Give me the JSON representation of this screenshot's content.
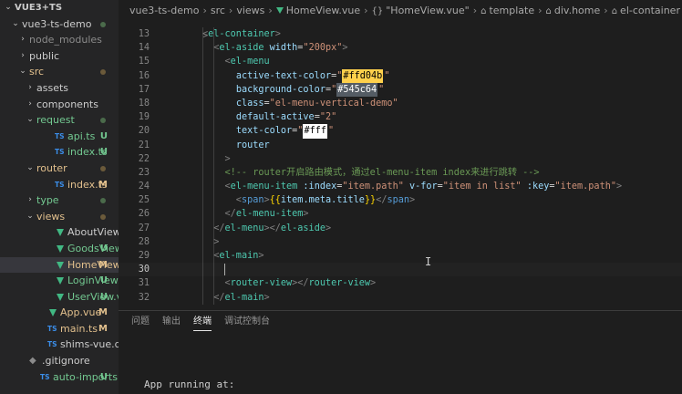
{
  "explorer": {
    "items": [
      {
        "label": "VUE3+TS",
        "kind": "root",
        "chev": "⌄",
        "depth": 0,
        "status": "",
        "status_color": ""
      },
      {
        "label": "vue3-ts-demo",
        "kind": "folder",
        "chev": "⌄",
        "depth": 1,
        "status": "dot",
        "color": "normal"
      },
      {
        "label": "node_modules",
        "kind": "folder",
        "chev": "›",
        "depth": 2,
        "status": "",
        "color": "dim"
      },
      {
        "label": "public",
        "kind": "folder",
        "chev": "›",
        "depth": 2,
        "status": "",
        "color": "normal"
      },
      {
        "label": "src",
        "kind": "folder",
        "chev": "⌄",
        "depth": 2,
        "status": "dot",
        "color": "brown"
      },
      {
        "label": "assets",
        "kind": "folder",
        "chev": "›",
        "depth": 3,
        "status": "",
        "color": "normal"
      },
      {
        "label": "components",
        "kind": "folder",
        "chev": "›",
        "depth": 3,
        "status": "",
        "color": "normal"
      },
      {
        "label": "request",
        "kind": "folder",
        "chev": "⌄",
        "depth": 3,
        "status": "dot",
        "color": "green"
      },
      {
        "label": "api.ts",
        "kind": "ts",
        "chev": "",
        "depth": 4,
        "status": "U",
        "color": "green"
      },
      {
        "label": "index.ts",
        "kind": "ts",
        "chev": "",
        "depth": 4,
        "status": "U",
        "color": "green"
      },
      {
        "label": "router",
        "kind": "folder",
        "chev": "⌄",
        "depth": 3,
        "status": "dot",
        "color": "brown"
      },
      {
        "label": "index.ts",
        "kind": "ts",
        "chev": "",
        "depth": 4,
        "status": "M",
        "color": "brown"
      },
      {
        "label": "type",
        "kind": "folder",
        "chev": "›",
        "depth": 3,
        "status": "dot",
        "color": "green"
      },
      {
        "label": "views",
        "kind": "folder",
        "chev": "⌄",
        "depth": 3,
        "status": "dot",
        "color": "brown"
      },
      {
        "label": "AboutView.vue",
        "kind": "vue",
        "chev": "",
        "depth": 4,
        "status": "",
        "color": "normal"
      },
      {
        "label": "GoodsView....",
        "kind": "vue",
        "chev": "",
        "depth": 4,
        "status": "U",
        "color": "green"
      },
      {
        "label": "HomeView....",
        "kind": "vue",
        "chev": "",
        "depth": 4,
        "status": "M",
        "color": "brown",
        "selected": true
      },
      {
        "label": "LoginView.vue",
        "kind": "vue",
        "chev": "",
        "depth": 4,
        "status": "U",
        "color": "green"
      },
      {
        "label": "UserView.vue",
        "kind": "vue",
        "chev": "",
        "depth": 4,
        "status": "U",
        "color": "green"
      },
      {
        "label": "App.vue",
        "kind": "vue",
        "chev": "",
        "depth": 3,
        "status": "M",
        "color": "brown"
      },
      {
        "label": "main.ts",
        "kind": "ts",
        "chev": "",
        "depth": 3,
        "status": "M",
        "color": "brown"
      },
      {
        "label": "shims-vue.d.ts",
        "kind": "ts",
        "chev": "",
        "depth": 3,
        "status": "",
        "color": "normal"
      },
      {
        "label": ".gitignore",
        "kind": "git",
        "chev": "",
        "depth": 2,
        "status": "",
        "color": "normal"
      },
      {
        "label": "auto-imports.d.ts",
        "kind": "ts",
        "chev": "",
        "depth": 2,
        "status": "U",
        "color": "green"
      }
    ]
  },
  "breadcrumb": {
    "project": "vue3-ts-demo",
    "src": "src",
    "views": "views",
    "file": "HomeView.vue",
    "scope": "\"HomeView.vue\"",
    "template": "template",
    "div": "div.home",
    "container": "el-container",
    "trail": "el-contai"
  },
  "editor": {
    "top_line": ">",
    "lines": [
      {
        "n": "13",
        "tokens": [
          [
            "punct",
            "<"
          ],
          [
            "tag",
            "el-container"
          ],
          [
            "punct",
            ">"
          ]
        ]
      },
      {
        "n": "14",
        "tokens": [
          [
            "punct",
            "  <"
          ],
          [
            "tag",
            "el-aside"
          ],
          [
            "text",
            " "
          ],
          [
            "attr",
            "width"
          ],
          [
            "eq",
            "="
          ],
          [
            "str",
            "\"200px\""
          ],
          [
            "punct",
            ">"
          ]
        ]
      },
      {
        "n": "15",
        "tokens": [
          [
            "punct",
            "    <"
          ],
          [
            "tag",
            "el-menu"
          ]
        ]
      },
      {
        "n": "16",
        "tokens": [
          [
            "text",
            "      "
          ],
          [
            "attr",
            "active-text-color"
          ],
          [
            "eq",
            "="
          ],
          [
            "str",
            "\""
          ],
          [
            "chipa",
            "#ffd04b"
          ],
          [
            "str",
            "\""
          ]
        ]
      },
      {
        "n": "17",
        "tokens": [
          [
            "text",
            "      "
          ],
          [
            "attr",
            "background-color"
          ],
          [
            "eq",
            "="
          ],
          [
            "str",
            "\""
          ],
          [
            "chipb",
            "#545c64"
          ],
          [
            "str",
            "\""
          ]
        ]
      },
      {
        "n": "18",
        "tokens": [
          [
            "text",
            "      "
          ],
          [
            "attr",
            "class"
          ],
          [
            "eq",
            "="
          ],
          [
            "str",
            "\"el-menu-vertical-demo\""
          ]
        ]
      },
      {
        "n": "19",
        "tokens": [
          [
            "text",
            "      "
          ],
          [
            "attr",
            "default-active"
          ],
          [
            "eq",
            "="
          ],
          [
            "str",
            "\"2\""
          ]
        ]
      },
      {
        "n": "20",
        "tokens": [
          [
            "text",
            "      "
          ],
          [
            "attr",
            "text-color"
          ],
          [
            "eq",
            "="
          ],
          [
            "str",
            "\""
          ],
          [
            "chipc",
            "#fff"
          ],
          [
            "str",
            "\""
          ]
        ]
      },
      {
        "n": "21",
        "tokens": [
          [
            "text",
            "      "
          ],
          [
            "attr",
            "router"
          ]
        ]
      },
      {
        "n": "22",
        "tokens": [
          [
            "punct",
            "    >"
          ]
        ]
      },
      {
        "n": "23",
        "tokens": [
          [
            "comment",
            "    <!-- router开启路由模式，通过el-menu-item index来进行跳转 -->"
          ]
        ]
      },
      {
        "n": "24",
        "tokens": [
          [
            "punct",
            "    <"
          ],
          [
            "tag",
            "el-menu-item"
          ],
          [
            "text",
            " "
          ],
          [
            "attr",
            ":index"
          ],
          [
            "eq",
            "="
          ],
          [
            "str",
            "\"item.path\""
          ],
          [
            "text",
            " "
          ],
          [
            "attr",
            "v-for"
          ],
          [
            "eq",
            "="
          ],
          [
            "str",
            "\"item in list\""
          ],
          [
            "text",
            " "
          ],
          [
            "attr",
            ":key"
          ],
          [
            "eq",
            "="
          ],
          [
            "str",
            "\"item.path\""
          ],
          [
            "punct",
            ">"
          ]
        ]
      },
      {
        "n": "25",
        "tokens": [
          [
            "punct",
            "      <"
          ],
          [
            "tag2",
            "span"
          ],
          [
            "punct",
            ">"
          ],
          [
            "mustache",
            "{{"
          ],
          [
            "expr",
            "item.meta.title"
          ],
          [
            "mustache",
            "}}"
          ],
          [
            "punct",
            "</"
          ],
          [
            "tag2",
            "span"
          ],
          [
            "punct",
            ">"
          ]
        ]
      },
      {
        "n": "26",
        "tokens": [
          [
            "punct",
            "    </"
          ],
          [
            "tag",
            "el-menu-item"
          ],
          [
            "punct",
            ">"
          ]
        ]
      },
      {
        "n": "27",
        "tokens": [
          [
            "punct",
            "  </"
          ],
          [
            "tag",
            "el-menu"
          ],
          [
            "punct",
            "></"
          ],
          [
            "tag",
            "el-aside"
          ],
          [
            "punct",
            ">"
          ]
        ]
      },
      {
        "n": "28",
        "tokens": [
          [
            "punct",
            "  >"
          ]
        ]
      },
      {
        "n": "29",
        "tokens": [
          [
            "punct",
            "  <"
          ],
          [
            "tag",
            "el-main"
          ],
          [
            "punct",
            ">"
          ]
        ]
      },
      {
        "n": "30",
        "tokens": [
          [
            "text",
            "    "
          ]
        ],
        "current": true
      },
      {
        "n": "31",
        "tokens": [
          [
            "punct",
            "    <"
          ],
          [
            "tag",
            "router-view"
          ],
          [
            "punct",
            "></"
          ],
          [
            "tag",
            "router-view"
          ],
          [
            "punct",
            ">"
          ]
        ]
      },
      {
        "n": "32",
        "tokens": [
          [
            "punct",
            "  </"
          ],
          [
            "tag",
            "el-main"
          ],
          [
            "punct",
            ">"
          ]
        ]
      }
    ]
  },
  "panel": {
    "tabs": [
      "问题",
      "输出",
      "终端",
      "调试控制台"
    ],
    "active_tab": 2,
    "terminal_text": "App running at:"
  },
  "colors": {
    "swatch_active_text": "#ffd04b",
    "swatch_background": "#545c64",
    "swatch_text": "#fff"
  }
}
